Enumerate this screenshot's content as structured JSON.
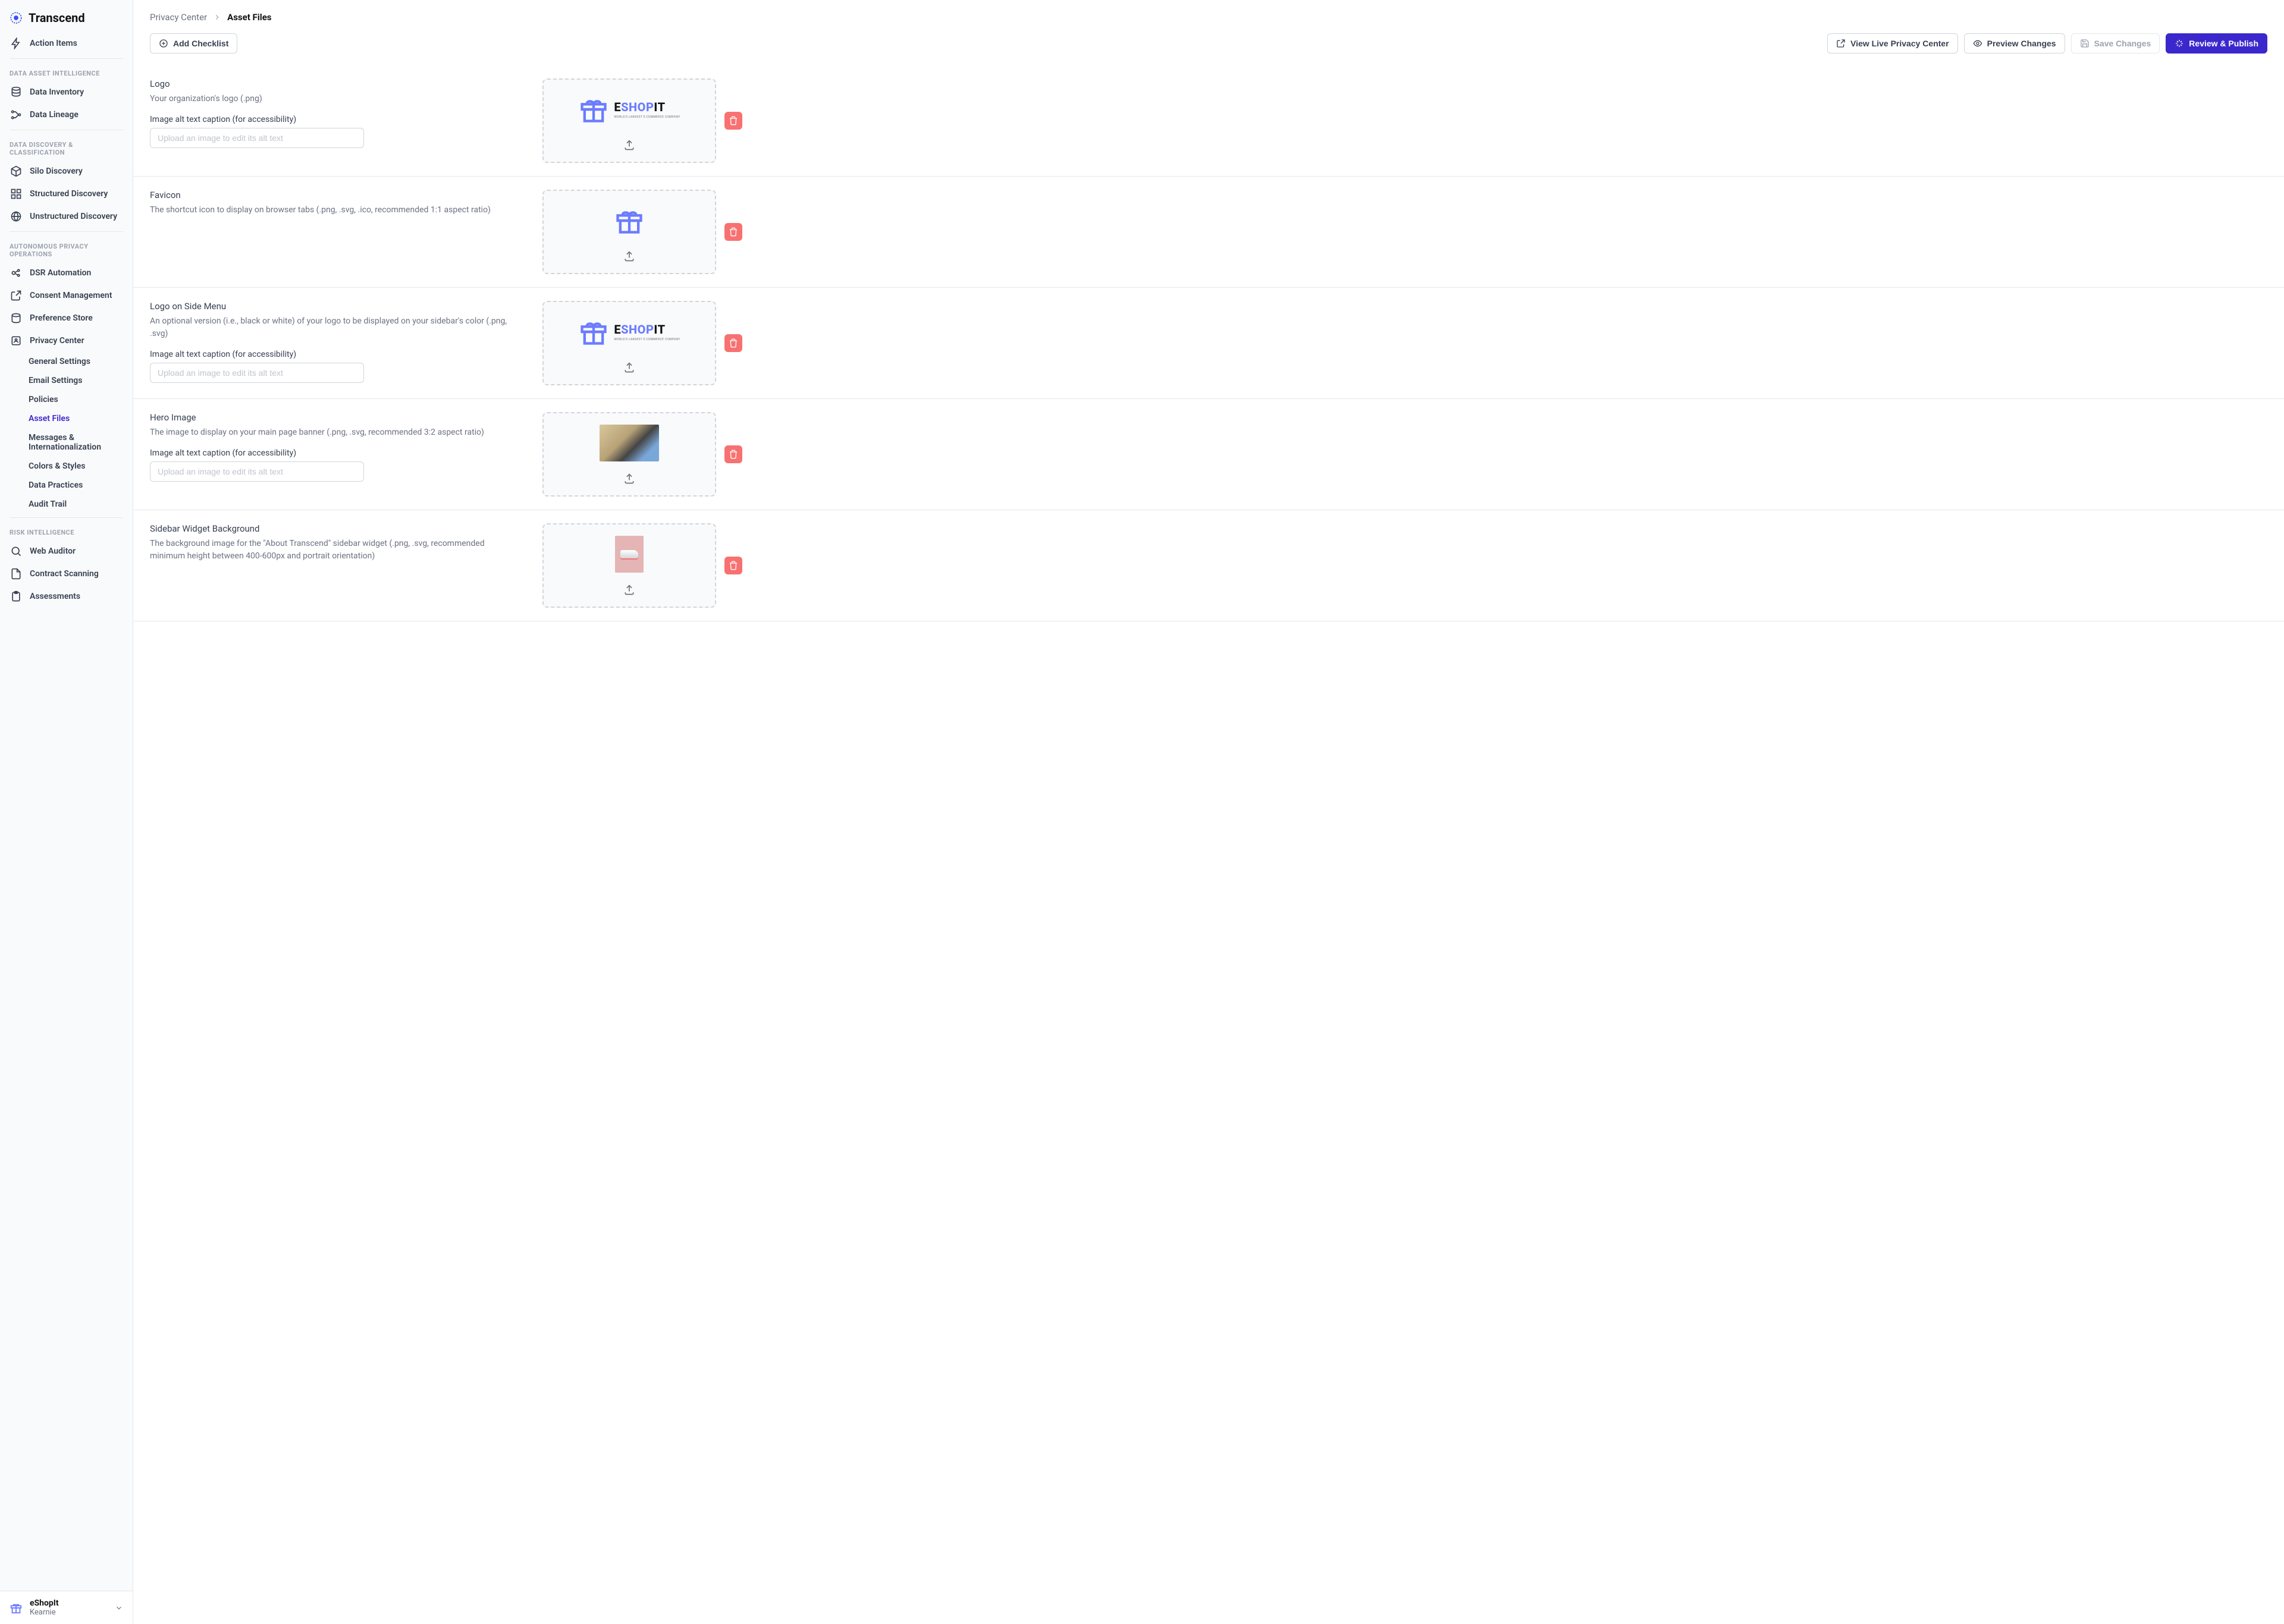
{
  "brand": "Transcend",
  "breadcrumb": {
    "parent": "Privacy Center",
    "current": "Asset Files"
  },
  "toolbar": {
    "add_checklist": "Add Checklist",
    "view_live": "View Live Privacy Center",
    "preview_changes": "Preview Changes",
    "save_changes": "Save Changes",
    "review_publish": "Review & Publish"
  },
  "sidebar": {
    "action_items": "Action Items",
    "sections": {
      "data_asset_intel": {
        "label": "DATA ASSET INTELLIGENCE",
        "items": [
          "Data Inventory",
          "Data Lineage"
        ]
      },
      "data_discovery": {
        "label": "DATA DISCOVERY & CLASSIFICATION",
        "items": [
          "Silo Discovery",
          "Structured Discovery",
          "Unstructured Discovery"
        ]
      },
      "autonomous_privacy": {
        "label": "AUTONOMOUS PRIVACY OPERATIONS",
        "items": [
          "DSR Automation",
          "Consent Management",
          "Preference Store",
          "Privacy Center"
        ],
        "privacy_center_sub": [
          "General Settings",
          "Email Settings",
          "Policies",
          "Asset Files",
          "Messages & Internationalization",
          "Colors & Styles",
          "Data Practices",
          "Audit Trail"
        ]
      },
      "risk_intel": {
        "label": "RISK INTELLIGENCE",
        "items": [
          "Web Auditor",
          "Contract Scanning",
          "Assessments"
        ]
      }
    },
    "footer": {
      "org": "eShopIt",
      "user": "Kearnie"
    }
  },
  "assets": [
    {
      "title": "Logo",
      "desc": "Your organization's logo (.png)",
      "has_alt": true,
      "alt_label": "Image alt text caption (for accessibility)",
      "alt_placeholder": "Upload an image to edit its alt text",
      "preview": "brand-logo"
    },
    {
      "title": "Favicon",
      "desc": "The shortcut icon to display on browser tabs (.png, .svg, .ico, recommended 1:1 aspect ratio)",
      "has_alt": false,
      "preview": "gift"
    },
    {
      "title": "Logo on Side Menu",
      "desc": "An optional version (i.e., black or white) of your logo to be displayed on your sidebar's color (.png, .svg)",
      "has_alt": true,
      "alt_label": "Image alt text caption (for accessibility)",
      "alt_placeholder": "Upload an image to edit its alt text",
      "preview": "brand-logo"
    },
    {
      "title": "Hero Image",
      "desc": "The image to display on your main page banner (.png, .svg, recommended 3:2 aspect ratio)",
      "has_alt": true,
      "alt_label": "Image alt text caption (for accessibility)",
      "alt_placeholder": "Upload an image to edit its alt text",
      "preview": "hero"
    },
    {
      "title": "Sidebar Widget Background",
      "desc": "The background image for the \"About Transcend\" sidebar widget (.png, .svg, recommended minimum height between 400-600px and portrait orientation)",
      "has_alt": false,
      "preview": "sidebar-widget"
    }
  ],
  "brand_preview": {
    "e": "E",
    "shop": "SHOP",
    "it": "IT",
    "sub": "WORLD'S LARGEST E-COMMERCE COMPANY"
  }
}
